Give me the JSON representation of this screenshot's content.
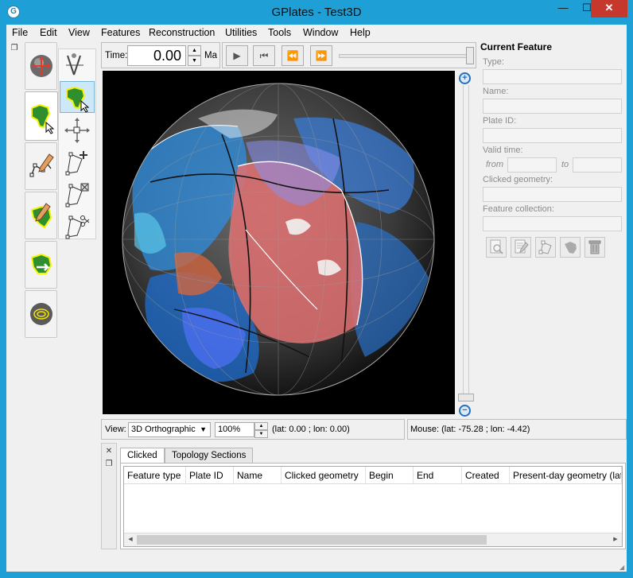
{
  "window": {
    "title": "GPlates - Test3D",
    "minimize": "—",
    "maximize": "☐",
    "close": "✕",
    "app_icon": "G"
  },
  "menu": [
    "File",
    "Edit",
    "View",
    "Features",
    "Reconstruction",
    "Utilities",
    "Tools",
    "Window",
    "Help"
  ],
  "toolbox": {
    "main_tools": [
      "drag-globe-icon",
      "feature-inspect-icon",
      "digitise-icon",
      "modify-geometry-icon",
      "reconstruct-icon",
      "small-circle-icon"
    ],
    "sub_tools": [
      "measure-distance-icon",
      "choose-feature-icon",
      "move-vertex-icon",
      "insert-vertex-icon",
      "delete-vertex-icon",
      "split-feature-icon"
    ]
  },
  "time": {
    "label": "Time:",
    "value": "0.00",
    "unit": "Ma"
  },
  "playback": {
    "icons": [
      "play-icon",
      "rewind-to-start-icon",
      "step-back-icon",
      "step-forward-icon"
    ]
  },
  "view": {
    "label": "View:",
    "projection": "3D Orthographic",
    "zoom": "100%",
    "camera_coords": "(lat: 0.00 ; lon: 0.00)"
  },
  "mouse": {
    "coords": "Mouse: (lat: -75.28 ; lon: -4.42)"
  },
  "current_feature": {
    "title": "Current Feature",
    "type_label": "Type:",
    "name_label": "Name:",
    "plate_id_label": "Plate ID:",
    "valid_time_label": "Valid time:",
    "from_label": "from",
    "to_label": "to",
    "clicked_geometry_label": "Clicked geometry:",
    "feature_collection_label": "Feature collection:"
  },
  "bottom_tabs": [
    "Clicked",
    "Topology Sections"
  ],
  "table": {
    "columns": [
      "Feature type",
      "Plate ID",
      "Name",
      "Clicked geometry",
      "Begin",
      "End",
      "Created",
      "Present-day geometry (lat"
    ],
    "rows": []
  },
  "colors": {
    "titlebar": "#1e9fd6",
    "close_button": "#c7382c",
    "panel_bg": "#f0f0f0",
    "globe_bg": "#000000"
  }
}
